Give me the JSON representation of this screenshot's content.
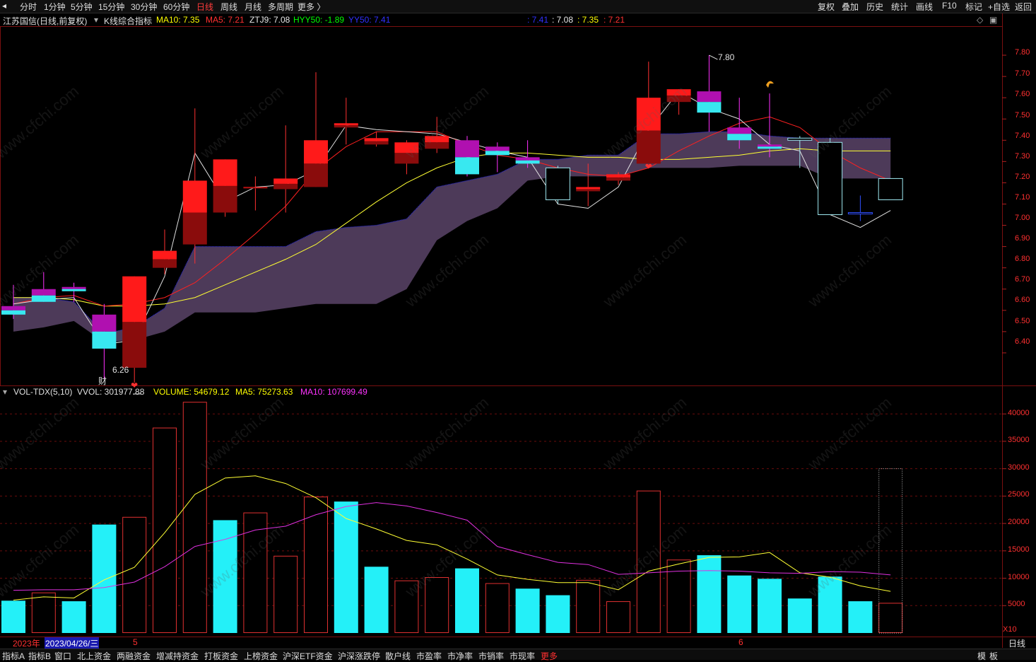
{
  "toolbar": {
    "left_icon": "back-arrow-icon",
    "periods": [
      "分时",
      "1分钟",
      "5分钟",
      "15分钟",
      "30分钟",
      "60分钟",
      "日线",
      "周线",
      "月线",
      "多周期",
      "更多 〉"
    ],
    "active_period": "日线",
    "right": [
      "复权",
      "叠加",
      "历史",
      "统计",
      "画线",
      "F10",
      "标记",
      "+自选",
      "返回"
    ]
  },
  "indicator_line": {
    "stock": "江苏国信(日线,前复权)",
    "indicator": "K线综合指标",
    "items": [
      {
        "label": "MA10: 7.35",
        "color": "#ffff00"
      },
      {
        "label": "MA5: 7.21",
        "color": "#ff3030"
      },
      {
        "label": "ZTJ9: 7.08",
        "color": "#e8e8e8"
      },
      {
        "label": "HYY50: -1.89",
        "color": "#00ff00"
      },
      {
        "label": "YY50: 7.41",
        "color": "#3030ff"
      }
    ],
    "right_items": [
      {
        "label": ": 7.41",
        "color": "#3030ff"
      },
      {
        "label": ": 7.08",
        "color": "#e8e8e8"
      },
      {
        "label": ": 7.35",
        "color": "#ffff00"
      },
      {
        "label": ": 7.21",
        "color": "#ff3030"
      }
    ]
  },
  "price_axis": [
    "7.80",
    "7.70",
    "7.60",
    "7.50",
    "7.40",
    "7.30",
    "7.20",
    "7.10",
    "7.00",
    "6.90",
    "6.80",
    "6.70",
    "6.60",
    "6.50",
    "6.40"
  ],
  "annotations": {
    "high": "7.80",
    "low": "6.26",
    "finance_mark": "财"
  },
  "volume_line": {
    "name": "VOL-TDX(5,10)",
    "vvol": "VVOL: 301977.88",
    "volume": "VOLUME: 54679.12",
    "ma5": "MA5: 75273.63",
    "ma10": "MA10: 107699.49"
  },
  "volume_axis": [
    "40000",
    "35000",
    "30000",
    "25000",
    "20000",
    "15000",
    "10000",
    "5000"
  ],
  "volume_unit": "X10",
  "date_bar": {
    "year": "2023年",
    "selected": "2023/04/26/三",
    "month5": "5",
    "month6": "6",
    "period": "日线"
  },
  "bottom_tabs": [
    "指标A",
    "指标B",
    "窗口",
    "北上资金",
    "两融资金",
    "增减持资金",
    "打板资金",
    "上榜资金",
    "沪深ETF资金",
    "沪深涨跌停",
    "散户线",
    "市盈率",
    "市净率",
    "市销率",
    "市现率",
    "更多"
  ],
  "bottom_right": [
    "模",
    "板"
  ],
  "watermark": "www.cfchi.com",
  "chart_data": {
    "type": "candlestick",
    "ohlc": [
      [
        6.62,
        6.72,
        6.56,
        6.58
      ],
      [
        6.64,
        6.78,
        6.64,
        6.7
      ],
      [
        6.71,
        6.73,
        6.64,
        6.69
      ],
      [
        6.58,
        6.63,
        6.28,
        6.42
      ],
      [
        6.76,
        6.76,
        6.26,
        6.33
      ],
      [
        6.8,
        6.98,
        6.77,
        6.88
      ],
      [
        7.21,
        7.55,
        6.82,
        6.91
      ],
      [
        7.31,
        7.31,
        7.04,
        7.06
      ],
      [
        7.18,
        7.23,
        7.07,
        7.18
      ],
      [
        7.22,
        7.47,
        7.06,
        7.17
      ],
      [
        7.4,
        7.72,
        7.18,
        7.18
      ],
      [
        7.48,
        7.6,
        7.38,
        7.46
      ],
      [
        7.38,
        7.44,
        7.37,
        7.41
      ],
      [
        7.29,
        7.4,
        7.24,
        7.39
      ],
      [
        7.36,
        7.51,
        7.34,
        7.42
      ],
      [
        7.4,
        7.42,
        7.23,
        7.24
      ],
      [
        7.33,
        7.39,
        7.25,
        7.37
      ],
      [
        7.29,
        7.4,
        7.27,
        7.32
      ],
      [
        7.27,
        7.28,
        7.1,
        7.12
      ],
      [
        7.16,
        7.29,
        7.09,
        7.18
      ],
      [
        7.24,
        7.25,
        7.19,
        7.21
      ],
      [
        7.29,
        7.77,
        7.29,
        7.6
      ],
      [
        7.58,
        7.64,
        7.52,
        7.64
      ],
      [
        7.63,
        7.8,
        7.44,
        7.53
      ],
      [
        7.46,
        7.6,
        7.36,
        7.4
      ],
      [
        7.38,
        7.62,
        7.32,
        7.36
      ],
      [
        7.41,
        7.42,
        7.27,
        7.4
      ],
      [
        7.39,
        7.41,
        7.05,
        7.05
      ],
      [
        7.06,
        7.14,
        7.02,
        7.06
      ],
      [
        7.12,
        7.22,
        7.12,
        7.22
      ]
    ],
    "candle_colors": [
      "purple",
      "purple",
      "purple",
      "purple",
      "red",
      "red",
      "red",
      "red",
      "red",
      "red",
      "red",
      "red",
      "red",
      "red",
      "red",
      "purple",
      "purple",
      "purple",
      "hollow",
      "red",
      "red",
      "red",
      "red",
      "purple",
      "purple",
      "purple",
      "hollow",
      "hollow",
      "blue",
      "hollow"
    ],
    "ma5": [
      6.63,
      6.66,
      6.67,
      6.62,
      6.63,
      6.66,
      6.73,
      6.84,
      6.96,
      7.09,
      7.26,
      7.37,
      7.44,
      7.44,
      7.44,
      7.38,
      7.33,
      7.31,
      7.27,
      7.24,
      7.23,
      7.27,
      7.35,
      7.42,
      7.48,
      7.51,
      7.46,
      7.35,
      7.27,
      7.21
    ],
    "ma10": [
      6.66,
      6.66,
      6.65,
      6.62,
      6.62,
      6.63,
      6.66,
      6.72,
      6.78,
      6.84,
      6.91,
      7.01,
      7.11,
      7.2,
      7.27,
      7.32,
      7.34,
      7.34,
      7.33,
      7.32,
      7.32,
      7.31,
      7.31,
      7.32,
      7.33,
      7.35,
      7.36,
      7.35,
      7.35,
      7.35
    ],
    "ztj9": [
      6.63,
      6.65,
      6.66,
      6.44,
      6.46,
      6.76,
      7.34,
      7.11,
      7.18,
      7.19,
      7.26,
      7.47,
      7.45,
      7.44,
      7.43,
      7.39,
      7.35,
      7.32,
      7.1,
      7.08,
      7.18,
      7.45,
      7.63,
      7.55,
      7.5,
      7.38,
      7.35,
      7.05,
      6.99,
      7.07
    ],
    "cloud_top": [
      6.66,
      6.66,
      6.64,
      6.49,
      6.52,
      6.61,
      6.9,
      6.9,
      6.9,
      6.9,
      6.97,
      6.99,
      7.0,
      7.03,
      7.18,
      7.21,
      7.24,
      7.31,
      7.31,
      7.33,
      7.33,
      7.43,
      7.43,
      7.44,
      7.44,
      7.42,
      7.41,
      7.41,
      7.41,
      7.41
    ],
    "cloud_bottom": [
      6.5,
      6.52,
      6.55,
      6.45,
      6.46,
      6.5,
      6.59,
      6.59,
      6.59,
      6.61,
      6.63,
      6.63,
      6.63,
      6.7,
      6.93,
      7.02,
      7.08,
      7.21,
      7.23,
      7.23,
      7.23,
      7.27,
      7.27,
      7.27,
      7.28,
      7.28,
      7.28,
      7.22,
      7.22,
      7.22
    ],
    "volume": [
      5900,
      7400,
      5800,
      19800,
      21200,
      37500,
      42200,
      20600,
      22000,
      14100,
      24900,
      24000,
      12100,
      9600,
      10200,
      11800,
      9100,
      8100,
      6900,
      9700,
      5800,
      26000,
      13400,
      14200,
      10500,
      9900,
      6300,
      10300,
      5800,
      5500
    ],
    "volume_colors": [
      "cyan",
      "red",
      "cyan",
      "cyan",
      "red",
      "red",
      "red",
      "cyan",
      "red",
      "red",
      "red",
      "cyan",
      "cyan",
      "red",
      "red",
      "cyan",
      "red",
      "cyan",
      "cyan",
      "red",
      "red",
      "red",
      "red",
      "cyan",
      "cyan",
      "cyan",
      "cyan",
      "cyan",
      "cyan",
      "red"
    ],
    "vol_ma5": [
      6000,
      6600,
      6400,
      9700,
      12000,
      18300,
      25300,
      28300,
      28700,
      27300,
      24700,
      20900,
      19000,
      16900,
      16100,
      13500,
      10600,
      9800,
      9200,
      9200,
      7900,
      11300,
      12600,
      13800,
      13900,
      14700,
      11000,
      10200,
      8600,
      7600
    ],
    "vol_ma10": [
      7800,
      7900,
      7900,
      8300,
      9300,
      12100,
      15800,
      17100,
      18800,
      19500,
      21600,
      23100,
      23800,
      23200,
      22000,
      20600,
      15800,
      14300,
      12900,
      12500,
      10700,
      11000,
      11300,
      11400,
      11300,
      11000,
      10900,
      11200,
      11100,
      10600
    ],
    "ylim": [
      6.28,
      7.87
    ],
    "vol_ylim": [
      0,
      43000
    ],
    "markers": {
      "high": {
        "index": 23,
        "value": 7.8
      },
      "low": {
        "index": 4,
        "value": 6.26
      },
      "butterflies": [
        4,
        21
      ],
      "finance_index": 3,
      "flag_index": 25
    }
  }
}
